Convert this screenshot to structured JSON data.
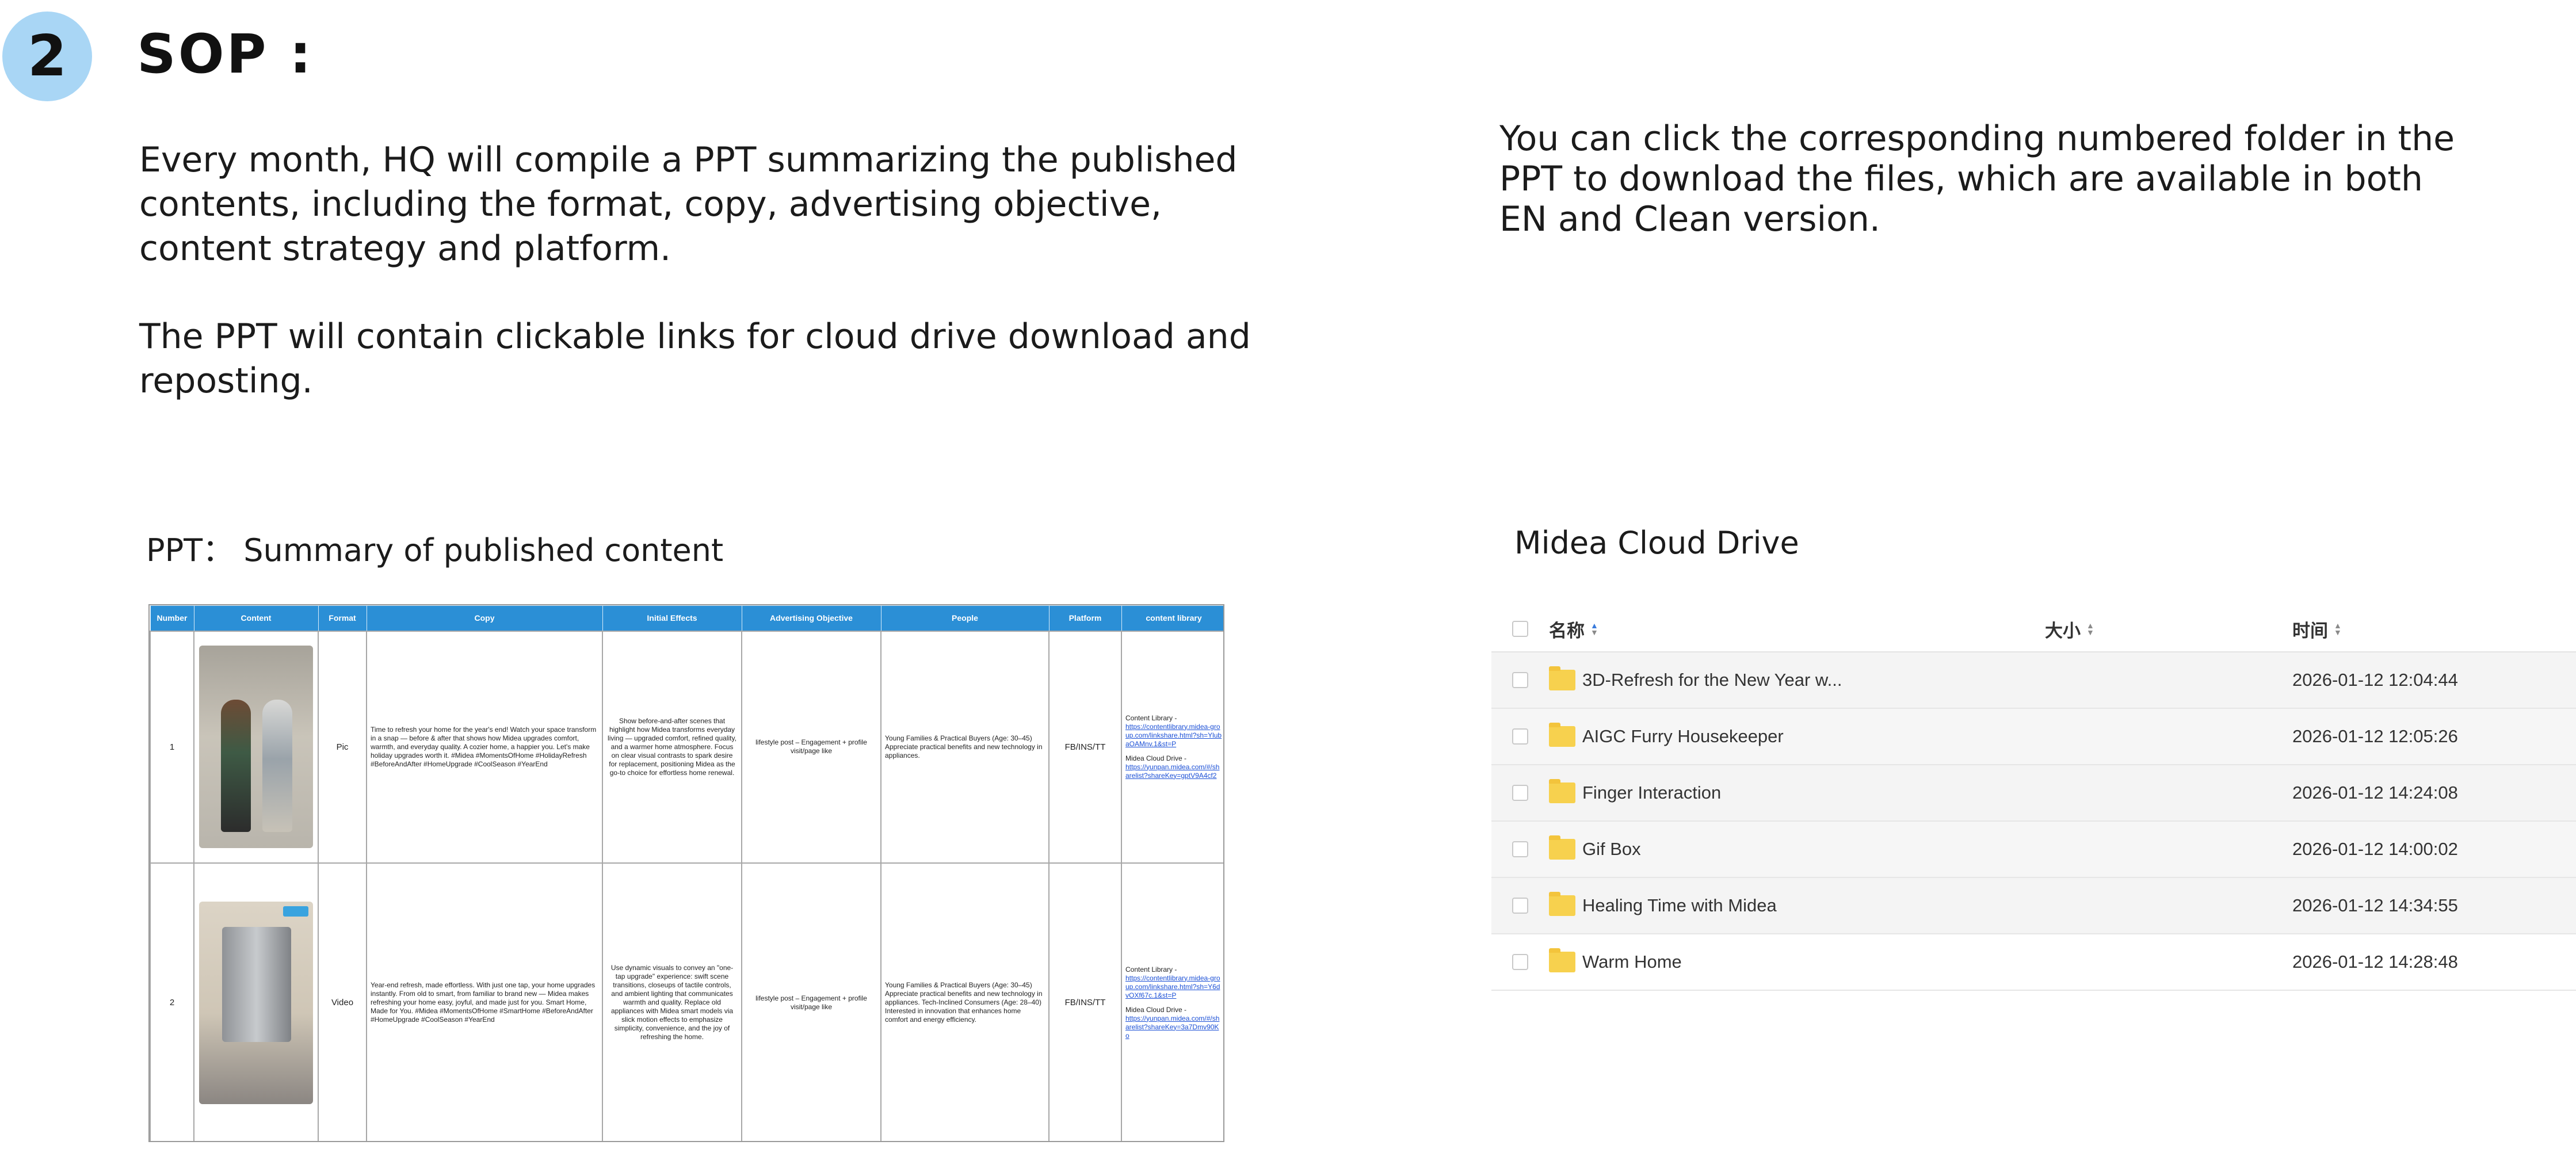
{
  "step": {
    "number": "2",
    "title": "SOP :"
  },
  "paragraphs": {
    "left_1": "Every month, HQ will compile a PPT summarizing the published contents, including the format, copy, advertising objective, content strategy and platform.",
    "left_2": "The PPT will contain clickable links for cloud drive download and reposting.",
    "right": "You can click the corresponding numbered folder in the PPT to download the files, which are available in both EN and Clean version."
  },
  "captions": {
    "ppt": "PPT： Summary of published content",
    "drive": "Midea Cloud Drive"
  },
  "ppt_table": {
    "headers": [
      "Number",
      "Content",
      "Format",
      "Copy",
      "Initial Effects",
      "Advertising Objective",
      "People",
      "Platform",
      "content library"
    ],
    "rows": [
      {
        "number": "1",
        "format": "Pic",
        "copy": "Time to refresh your home for the year's end! Watch your space transform in a snap — before & after that shows how Midea upgrades comfort, warmth, and everyday quality. A cozier home, a happier you. Let's make holiday upgrades worth it. #Midea #MomentsOfHome #HolidayRefresh #BeforeAndAfter #HomeUpgrade #CoolSeason #YearEnd",
        "effects": "Show before-and-after scenes that highlight how Midea transforms everyday living — upgraded comfort, refined quality, and a warmer home atmosphere. Focus on clear visual contrasts to spark desire for replacement, positioning Midea as the go-to choice for effortless home renewal.",
        "objective": "lifestyle post – Engagement + profile visit/page like",
        "people": "Young Families & Practical Buyers (Age: 30–45) Appreciate practical benefits and new technology in appliances.",
        "platform": "FB/INS/TT",
        "library_title": "Content Library -",
        "library_link": "https://contentlibrary.midea-group.com/linkshare.html?sh=YlubaOAMnv.1&st=P",
        "drive_title": "Midea Cloud Drive -",
        "drive_link": "https://yunpan.midea.com/#/sharelist?shareKey=gptV9A4cf2"
      },
      {
        "number": "2",
        "format": "Video",
        "copy": "Year-end refresh, made effortless. With just one tap, your home upgrades instantly. From old to smart, from familiar to brand new — Midea makes refreshing your home easy, joyful, and made just for you. Smart Home, Made for You. #Midea #MomentsOfHome #SmartHome #BeforeAndAfter #HomeUpgrade #CoolSeason #YearEnd",
        "effects": "Use dynamic visuals to convey an \"one-tap upgrade\" experience: swift scene transitions, closeups of tactile controls, and ambient lighting that communicates warmth and quality. Replace old appliances with Midea smart models via slick motion effects to emphasize simplicity, convenience, and the joy of refreshing the home.",
        "objective": "lifestyle post – Engagement + profile visit/page like",
        "people": "Young Families & Practical Buyers (Age: 30–45) Appreciate practical benefits and new technology in appliances. Tech-Inclined Consumers (Age: 28–40) Interested in innovation that enhances home comfort and energy efficiency.",
        "platform": "FB/INS/TT",
        "library_title": "Content Library -",
        "library_link": "https://contentlibrary.midea-group.com/linkshare.html?sh=Y6dvOXf67c.1&st=P",
        "drive_title": "Midea Cloud Drive -",
        "drive_link": "https://yunpan.midea.com/#/sharelist?shareKey=3a7Dmv90Ko"
      }
    ]
  },
  "drive": {
    "headers": {
      "name": "名称",
      "size": "大小",
      "time": "时间"
    },
    "rows": [
      {
        "name": "3D-Refresh for the New Year w...",
        "size": "",
        "time": "2026-01-12 12:04:44"
      },
      {
        "name": "AIGC Furry Housekeeper",
        "size": "",
        "time": "2026-01-12 12:05:26"
      },
      {
        "name": "Finger Interaction",
        "size": "",
        "time": "2026-01-12 14:24:08"
      },
      {
        "name": "Gif Box",
        "size": "",
        "time": "2026-01-12 14:00:02"
      },
      {
        "name": "Healing Time with Midea",
        "size": "",
        "time": "2026-01-12 14:34:55"
      },
      {
        "name": "Warm Home",
        "size": "",
        "time": "2026-01-12 14:28:48"
      }
    ],
    "colors": {
      "folder": "#f7d14e",
      "sort_active": "#3a7bdc"
    }
  },
  "colors": {
    "step_circle": "#a9d6f5",
    "table_header": "#2b8fd6",
    "link": "#1a4fd6"
  }
}
